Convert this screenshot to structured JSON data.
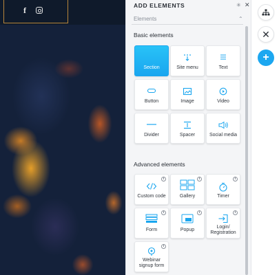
{
  "canvas": {
    "social_icons": [
      "facebook-icon",
      "instagram-icon"
    ],
    "facebook_glyph": "f"
  },
  "panel": {
    "title": "ADD ELEMENTS",
    "subheading": "Elements",
    "basic_label": "Basic elements",
    "advanced_label": "Advanced elements",
    "basic_elements": [
      {
        "label": "Section",
        "icon": "section-icon",
        "selected": true
      },
      {
        "label": "Site menu",
        "icon": "site-menu-icon"
      },
      {
        "label": "Text",
        "icon": "text-icon"
      },
      {
        "label": "Button",
        "icon": "button-icon"
      },
      {
        "label": "Image",
        "icon": "image-icon"
      },
      {
        "label": "Video",
        "icon": "video-icon"
      },
      {
        "label": "Divider",
        "icon": "divider-icon"
      },
      {
        "label": "Spacer",
        "icon": "spacer-icon"
      },
      {
        "label": "Social media",
        "icon": "social-media-icon"
      }
    ],
    "advanced_elements": [
      {
        "label": "Custom code",
        "icon": "code-icon",
        "badge": "clock-icon"
      },
      {
        "label": "Gallery",
        "icon": "gallery-icon",
        "badge": "clock-icon"
      },
      {
        "label": "Timer",
        "icon": "timer-icon",
        "badge": "clock-icon"
      },
      {
        "label": "Form",
        "icon": "form-icon",
        "badge": "clock-icon"
      },
      {
        "label": "Popup",
        "icon": "popup-icon",
        "badge": "clock-icon"
      },
      {
        "label": "Login/\nRegistration",
        "label_line1": "Login/",
        "label_line2": "Registration",
        "icon": "login-icon",
        "badge": "clock-icon"
      },
      {
        "label": "Webinar signup form",
        "label_line1": "Webinar",
        "label_line2": "signup form",
        "icon": "webinar-icon",
        "badge": "clock-icon"
      }
    ]
  },
  "rail": {
    "buttons": [
      "sitemap-icon",
      "close-icon",
      "add-icon"
    ],
    "add_glyph": "+",
    "close_glyph": "✕"
  },
  "colors": {
    "accent": "#1ca7f0",
    "canvas_bg": "#14213a",
    "panel_bg": "#f4f5f7",
    "social_border": "#b8863a"
  }
}
